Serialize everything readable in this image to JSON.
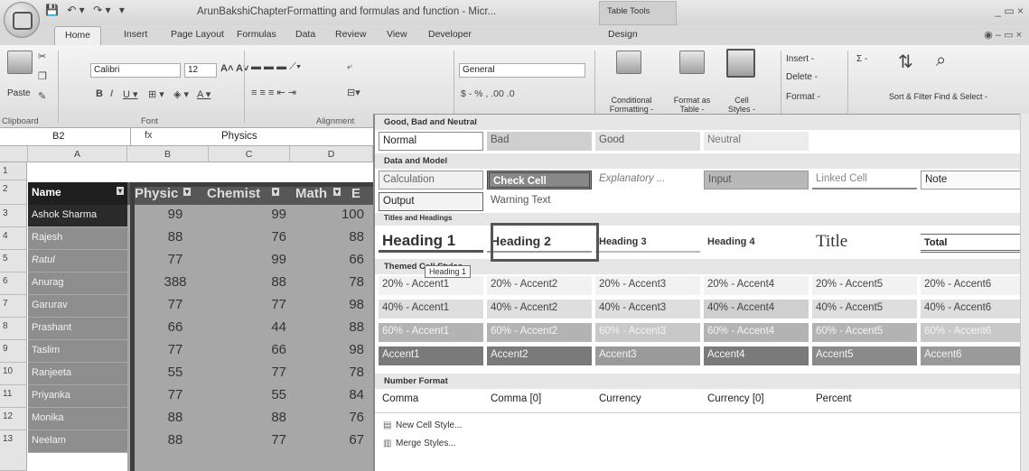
{
  "window": {
    "title": "ArunBakshiChapterFormatting and formulas and function - Micr...",
    "context_tab_group": "Table Tools",
    "controls": "_ ▭ ×"
  },
  "quick_access": [
    "💾",
    "↶ ▾",
    "↷ ▾",
    "▾"
  ],
  "tabs": [
    "Home",
    "Insert",
    "Page Layout",
    "Formulas",
    "Data",
    "Review",
    "View",
    "Developer",
    "Design"
  ],
  "ribbon": {
    "clipboard": {
      "paste": "Paste",
      "label": "Clipboard"
    },
    "font": {
      "name": "Calibri",
      "size": "12",
      "label": "Font"
    },
    "alignment": {
      "label": "Alignment"
    },
    "number": {
      "format": "General",
      "buttons": "$ - % , .00 .0"
    },
    "styles": {
      "conditional": "Conditional Formatting -",
      "format_table": "Format as Table -",
      "cell_styles": "Cell Styles -"
    },
    "cells": {
      "insert": "Insert -",
      "delete": "Delete -",
      "format": "Format -"
    },
    "editing": {
      "sum": "Σ -",
      "sort": "Sort & Filter -",
      "find": "Find & Select -"
    }
  },
  "formula_bar": {
    "cell": "B2",
    "fx": "fx",
    "value": "Physics"
  },
  "sheet": {
    "columns": [
      "A",
      "B",
      "C",
      "D"
    ],
    "row_numbers": [
      "1",
      "2",
      "3",
      "4",
      "5",
      "6",
      "7",
      "8",
      "9",
      "10",
      "11",
      "12",
      "13"
    ],
    "headers": [
      "Name",
      "Physic",
      "Chemist",
      "Math",
      "E"
    ],
    "rows": [
      {
        "name": "Ashok Sharma",
        "vals": [
          "99",
          "99",
          "100"
        ]
      },
      {
        "name": "Rajesh",
        "vals": [
          "88",
          "76",
          "88"
        ]
      },
      {
        "name": "Ratul",
        "vals": [
          "77",
          "99",
          "66"
        ]
      },
      {
        "name": "Anurag",
        "vals": [
          "388",
          "88",
          "78"
        ]
      },
      {
        "name": "Garurav",
        "vals": [
          "77",
          "77",
          "98"
        ]
      },
      {
        "name": "Prashant",
        "vals": [
          "66",
          "44",
          "88"
        ]
      },
      {
        "name": "Taslim",
        "vals": [
          "77",
          "66",
          "98"
        ]
      },
      {
        "name": "Ranjeeta",
        "vals": [
          "55",
          "77",
          "78"
        ]
      },
      {
        "name": "Priyanka",
        "vals": [
          "77",
          "55",
          "84"
        ]
      },
      {
        "name": "Monika",
        "vals": [
          "88",
          "88",
          "76"
        ]
      },
      {
        "name": "Neelam",
        "vals": [
          "88",
          "77",
          "67"
        ]
      }
    ]
  },
  "gallery": {
    "sections": [
      "Good, Bad and Neutral",
      "Data and Model",
      "Titles and Headings",
      "Themed Cell Styles",
      "Number Format"
    ],
    "good_bad": [
      "Normal",
      "Bad",
      "Good",
      "Neutral"
    ],
    "data_model_1": [
      "Calculation",
      "Check Cell",
      "Explanatory ...",
      "Input",
      "Linked Cell",
      "Note"
    ],
    "data_model_2": [
      "Output",
      "Warning Text"
    ],
    "headings": [
      "Heading 1",
      "Heading 2",
      "Heading 3",
      "Heading 4",
      "Title",
      "Total"
    ],
    "accent20": [
      "20% - Accent1",
      "20% - Accent2",
      "20% - Accent3",
      "20% - Accent4",
      "20% - Accent5",
      "20% - Accent6"
    ],
    "accent40": [
      "40% - Accent1",
      "40% - Accent2",
      "40% - Accent3",
      "40% - Accent4",
      "40% - Accent5",
      "40% - Accent6"
    ],
    "accent60": [
      "60% - Accent1",
      "60% - Accent2",
      "60% - Accent3",
      "60% - Accent4",
      "60% - Accent5",
      "60% - Accent6"
    ],
    "accent": [
      "Accent1",
      "Accent2",
      "Accent3",
      "Accent4",
      "Accent5",
      "Accent6"
    ],
    "number": [
      "Comma",
      "Comma [0]",
      "Currency",
      "Currency [0]",
      "Percent"
    ],
    "tooltip": "Heading 1",
    "menu": [
      "New Cell Style...",
      "Merge Styles..."
    ]
  }
}
